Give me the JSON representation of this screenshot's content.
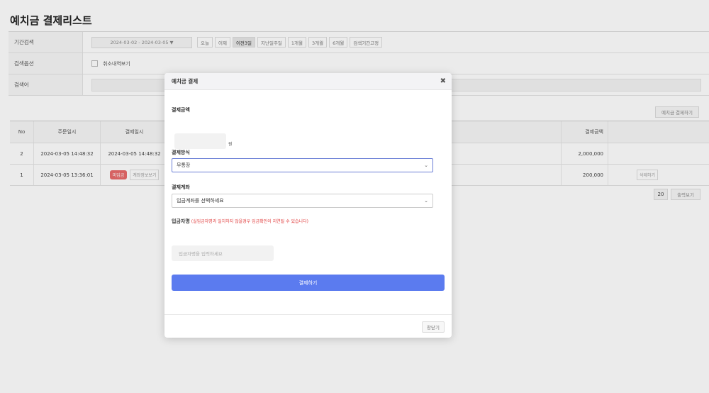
{
  "page": {
    "title": "예치금 결제리스트"
  },
  "filter": {
    "period_label": "기간검색",
    "date_range": "2024-03-02 - 2024-03-05 ▼",
    "quick_buttons": [
      {
        "label": "오늘",
        "active": false
      },
      {
        "label": "어제",
        "active": false
      },
      {
        "label": "이전3일",
        "active": true
      },
      {
        "label": "지난일주일",
        "active": false
      },
      {
        "label": "1개월",
        "active": false
      },
      {
        "label": "3개월",
        "active": false
      },
      {
        "label": "6개월",
        "active": false
      },
      {
        "label": "검색기간고정",
        "active": false
      }
    ],
    "option_label": "검색옵션",
    "option_checkbox": "취소내역보기",
    "keyword_label": "검색어"
  },
  "toolbar": {
    "deposit_button": "예치금 결제하기"
  },
  "table": {
    "headers": {
      "no": "No",
      "order_date": "주문일시",
      "pay_date": "결제일시",
      "amount": "결제금액"
    },
    "rows": [
      {
        "no": "2",
        "order_date": "2024-03-05 14:48:32",
        "pay_date": "2024-03-05 14:48:32",
        "amount": "2,000,000"
      },
      {
        "no": "1",
        "order_date": "2024-03-05 13:36:01",
        "badge": "미입금",
        "info_button": "계좌정보보기",
        "amount": "200,000",
        "delete_button": "삭제하기"
      }
    ]
  },
  "pagination": {
    "page_size": "20",
    "view_button": "출력보기"
  },
  "modal": {
    "title": "예치금 결제",
    "amount_label": "결제금액",
    "currency": "원",
    "method_label": "결제방식",
    "method_value": "무통장",
    "account_label": "결제계좌",
    "account_placeholder": "입금계좌를 선택하세요",
    "depositor_label": "입금자명",
    "depositor_notice": "(실입금자명과 일치하지 않을경우 입금확인이 지연될 수 있습니다)",
    "depositor_placeholder": "입금자명을 입력하세요",
    "pay_button": "결제하기",
    "close_button": "창닫기"
  },
  "colors": {
    "accent": "#5b7bef",
    "badge": "#e96b6b",
    "notice": "#e03a3a"
  }
}
